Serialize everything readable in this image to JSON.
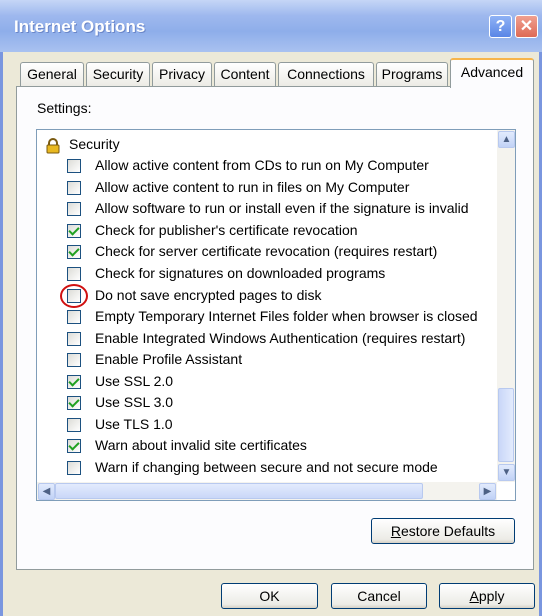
{
  "window": {
    "title": "Internet Options",
    "help_label": "?",
    "close_label": "✕"
  },
  "tabs": [
    {
      "label": "General"
    },
    {
      "label": "Security"
    },
    {
      "label": "Privacy"
    },
    {
      "label": "Content"
    },
    {
      "label": "Connections"
    },
    {
      "label": "Programs"
    },
    {
      "label": "Advanced",
      "active": true
    }
  ],
  "settings_label": "Settings:",
  "group": {
    "label": "Security",
    "icon": "lock-icon"
  },
  "items": [
    {
      "label": "Allow active content from CDs to run on My Computer",
      "checked": false
    },
    {
      "label": "Allow active content to run in files on My Computer",
      "checked": false
    },
    {
      "label": "Allow software to run or install even if the signature is invalid",
      "checked": false
    },
    {
      "label": "Check for publisher's certificate revocation",
      "checked": true
    },
    {
      "label": "Check for server certificate revocation (requires restart)",
      "checked": true
    },
    {
      "label": "Check for signatures on downloaded programs",
      "checked": false
    },
    {
      "label": "Do not save encrypted pages to disk",
      "checked": false,
      "highlighted": true
    },
    {
      "label": "Empty Temporary Internet Files folder when browser is closed",
      "checked": false
    },
    {
      "label": "Enable Integrated Windows Authentication (requires restart)",
      "checked": false
    },
    {
      "label": "Enable Profile Assistant",
      "checked": false
    },
    {
      "label": "Use SSL 2.0",
      "checked": true
    },
    {
      "label": "Use SSL 3.0",
      "checked": true
    },
    {
      "label": "Use TLS 1.0",
      "checked": false
    },
    {
      "label": "Warn about invalid site certificates",
      "checked": true
    },
    {
      "label": "Warn if changing between secure and not secure mode",
      "checked": false
    }
  ],
  "buttons": {
    "restore_defaults": {
      "accel": "R",
      "rest": "estore Defaults"
    },
    "ok": "OK",
    "cancel": "Cancel",
    "apply": {
      "accel": "A",
      "rest": "pply"
    }
  },
  "colors": {
    "highlight_ring": "#d01010",
    "check": "#21a121",
    "tab_active_accent": "#f7b54a"
  }
}
